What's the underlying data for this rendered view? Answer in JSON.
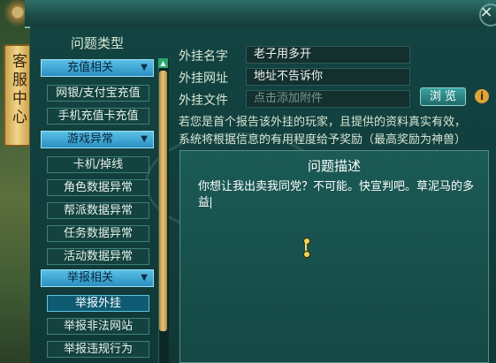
{
  "window": {
    "close_glyph": "×"
  },
  "side_tab": {
    "label": "客服中心"
  },
  "menu": {
    "title": "问题类型",
    "groups": [
      {
        "label": "充值相关",
        "items": [
          "网银/支付宝充值",
          "手机充值卡充值"
        ]
      },
      {
        "label": "游戏异常",
        "items": [
          "卡机/掉线",
          "角色数据异常",
          "帮派数据异常",
          "任务数据异常",
          "活动数据异常"
        ]
      },
      {
        "label": "举报相关",
        "items": [
          "举报外挂",
          "举报非法网站",
          "举报违规行为"
        ]
      }
    ],
    "selected_item": "举报外挂"
  },
  "form": {
    "name_label": "外挂名字",
    "name_value": "老子用多开",
    "url_label": "外挂网址",
    "url_value": "地址不告诉你",
    "file_label": "外挂文件",
    "file_placeholder": "点击添加附件",
    "browse_label": "浏 览",
    "info_glyph": "i"
  },
  "notice": {
    "line1": "若您是首个报告该外挂的玩家，且提供的资料真实有效，",
    "line2": "系统将根据信息的有用程度给予奖励（最高奖励为神兽）"
  },
  "description": {
    "title": "问题描述",
    "text": "你想让我出卖我同党？不可能。快宣判吧。草泥马的多益"
  },
  "colors": {
    "menu_header": "#2a8fc0",
    "accent_gold": "#e6c27a",
    "panel_bg": "#134442"
  },
  "icons": {
    "close": "close-icon",
    "info": "info-icon",
    "chevron": "chevron-down-icon"
  }
}
